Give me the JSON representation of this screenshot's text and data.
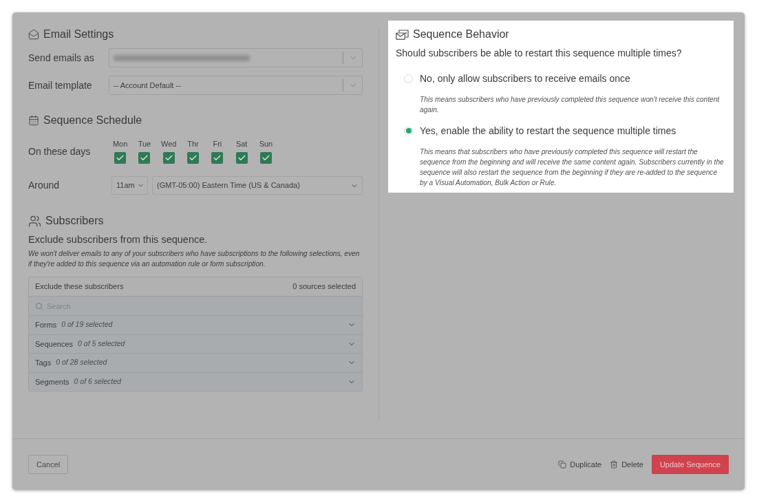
{
  "email_settings": {
    "title": "Email Settings",
    "fields": [
      {
        "label": "Send emails as",
        "redacted": true
      },
      {
        "label": "Email template",
        "redacted": false,
        "value": "-- Account Default --"
      }
    ]
  },
  "sequence_schedule": {
    "title": "Sequence Schedule",
    "days_label": "On these days",
    "days": [
      {
        "label": "Mon",
        "checked": true
      },
      {
        "label": "Tue",
        "checked": true
      },
      {
        "label": "Wed",
        "checked": true
      },
      {
        "label": "Thr",
        "checked": true
      },
      {
        "label": "Fri",
        "checked": true
      },
      {
        "label": "Sat",
        "checked": true
      },
      {
        "label": "Sun",
        "checked": true
      }
    ],
    "around_label": "Around",
    "time": "11am",
    "timezone": "(GMT-05:00) Eastern Time (US & Canada)"
  },
  "subscribers": {
    "title": "Subscribers",
    "subtitle": "Exclude subscribers from this sequence.",
    "note": "We won't deliver emails to any of your subscribers who have subscriptions to the following selections, even if they're added to this sequence via an automation rule or form subscription.",
    "exclude_panel": {
      "title": "Exclude these subscribers",
      "count": "0 sources selected",
      "search_placeholder": "Search",
      "groups": [
        {
          "name": "Forms",
          "summary": "0 of 19 selected",
          "expanded": false
        },
        {
          "name": "Sequences",
          "summary": "0 of 5 selected",
          "expanded": false
        },
        {
          "name": "Tags",
          "summary": "0 of 28 selected",
          "expanded": false
        },
        {
          "name": "Segments",
          "summary": "0 of 6 selected",
          "expanded": false
        }
      ]
    }
  },
  "sequence_behavior": {
    "title": "Sequence Behavior",
    "question": "Should subscribers be able to restart this sequence multiple times?",
    "options": [
      {
        "label": "No, only allow subscribers to receive emails once",
        "description": "This means subscribers who have previously completed this sequence won't receive this content again.",
        "selected": false
      },
      {
        "label": "Yes, enable the ability to restart the sequence multiple times",
        "description": "This means that subscribers who have previously completed this sequence will restart the sequence from the beginning and will receive the same content again. Subscribers currently in the sequence will also restart the sequence from the beginning if they are re-added to the sequence by a Visual Automation, Bulk Action or Rule.",
        "selected": true
      }
    ]
  },
  "footer": {
    "cancel": "Cancel",
    "actions": [
      {
        "kind": "duplicate",
        "label": "Duplicate"
      },
      {
        "kind": "delete",
        "label": "Delete"
      }
    ],
    "primary": "Update Sequence"
  }
}
